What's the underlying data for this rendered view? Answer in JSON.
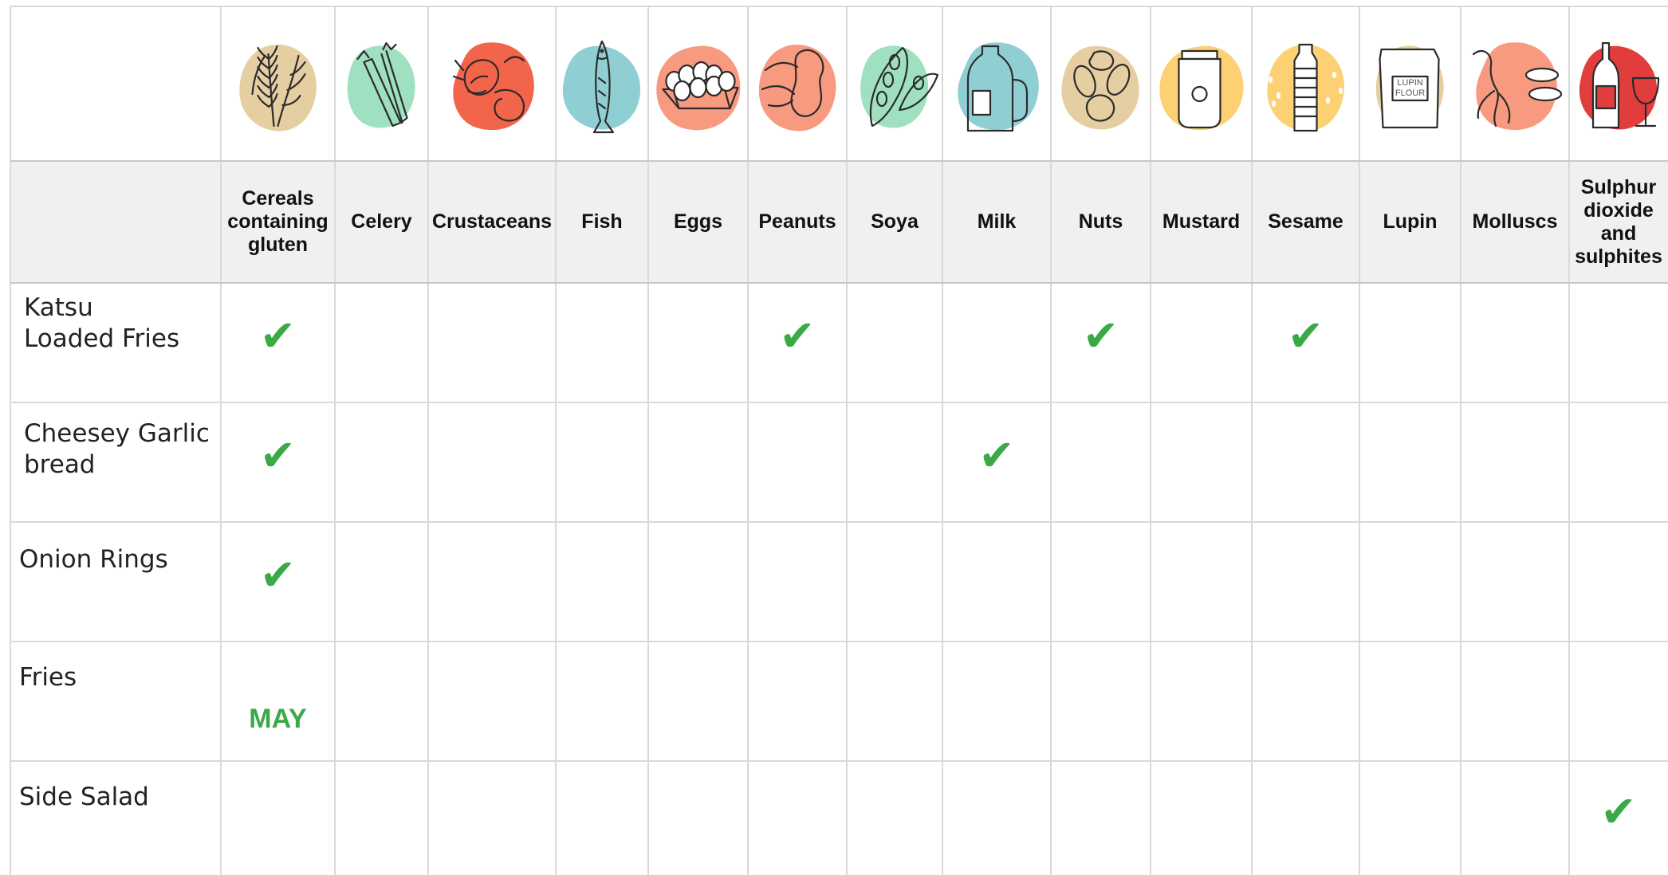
{
  "chart_data": {
    "type": "table",
    "columns": [
      {
        "key": "gluten",
        "label": "Cereals containing gluten",
        "icon": "wheat-icon",
        "blob": "#e6cea3"
      },
      {
        "key": "celery",
        "label": "Celery",
        "icon": "celery-icon",
        "blob": "#9fe0c0"
      },
      {
        "key": "crustaceans",
        "label": "Crustaceans",
        "icon": "shrimp-icon",
        "blob": "#f2654a"
      },
      {
        "key": "fish",
        "label": "Fish",
        "icon": "fish-icon",
        "blob": "#8fcfd3"
      },
      {
        "key": "eggs",
        "label": "Eggs",
        "icon": "eggs-icon",
        "blob": "#f79a80"
      },
      {
        "key": "peanuts",
        "label": "Peanuts",
        "icon": "peanut-icon",
        "blob": "#f79a80"
      },
      {
        "key": "soya",
        "label": "Soya",
        "icon": "soybean-icon",
        "blob": "#9fe0c0"
      },
      {
        "key": "milk",
        "label": "Milk",
        "icon": "milk-bottle-icon",
        "blob": "#8fcfd3"
      },
      {
        "key": "nuts",
        "label": "Nuts",
        "icon": "nuts-icon",
        "blob": "#e6cea3"
      },
      {
        "key": "mustard",
        "label": "Mustard",
        "icon": "mustard-jar-icon",
        "blob": "#fdd173"
      },
      {
        "key": "sesame",
        "label": "Sesame",
        "icon": "sesame-oil-icon",
        "blob": "#fdd173"
      },
      {
        "key": "lupin",
        "label": "Lupin",
        "icon": "lupin-flour-icon",
        "blob": "#e6cea3",
        "icon_text": "LUPIN FLOUR"
      },
      {
        "key": "molluscs",
        "label": "Molluscs",
        "icon": "squid-icon",
        "blob": "#f79a80"
      },
      {
        "key": "sulphites",
        "label": "Sulphur dioxide and sulphites",
        "icon": "wine-icon",
        "blob": "#e23d3d"
      }
    ],
    "rows": [
      {
        "dish": "Katsu\nLoaded Fries",
        "values": [
          "✔",
          "",
          "",
          "",
          "",
          "✔",
          "",
          "",
          "✔",
          "",
          "✔",
          "",
          "",
          ""
        ]
      },
      {
        "dish": "Cheesey Garlic\nbread",
        "values": [
          "✔",
          "",
          "",
          "",
          "",
          "",
          "",
          "✔",
          "",
          "",
          "",
          "",
          "",
          ""
        ]
      },
      {
        "dish": "Onion Rings",
        "values": [
          "✔",
          "",
          "",
          "",
          "",
          "",
          "",
          "",
          "",
          "",
          "",
          "",
          "",
          ""
        ]
      },
      {
        "dish": "Fries",
        "values": [
          "MAY",
          "",
          "",
          "",
          "",
          "",
          "",
          "",
          "",
          "",
          "",
          "",
          "",
          ""
        ]
      },
      {
        "dish": "Side Salad",
        "values": [
          "",
          "",
          "",
          "",
          "",
          "",
          "",
          "",
          "",
          "",
          "",
          "",
          "",
          "✔"
        ]
      }
    ],
    "colors": {
      "grid": "#d9d9d9",
      "header_band": "#f0f0f0",
      "mark": "#3aaa47"
    }
  }
}
